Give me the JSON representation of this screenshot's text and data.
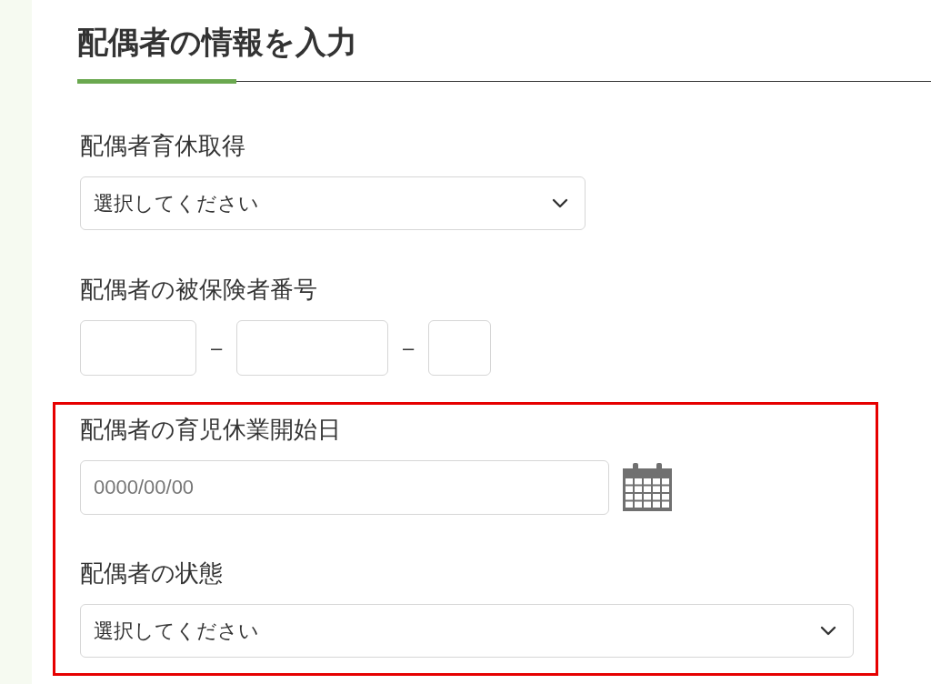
{
  "heading": "配偶者の情報を入力",
  "sections": [
    {
      "highlighted": false,
      "fields": [
        {
          "kind": "select",
          "label": "配偶者育休取得",
          "value": "選択してください"
        },
        {
          "kind": "split",
          "label": "配偶者の被保険者番号",
          "separators": [
            "–",
            "–"
          ]
        }
      ]
    },
    {
      "highlighted": true,
      "fields": [
        {
          "kind": "date",
          "label": "配偶者の育児休業開始日",
          "placeholder": "0000/00/00"
        },
        {
          "kind": "select",
          "label": "配偶者の状態",
          "value": "選択してください"
        }
      ]
    }
  ]
}
